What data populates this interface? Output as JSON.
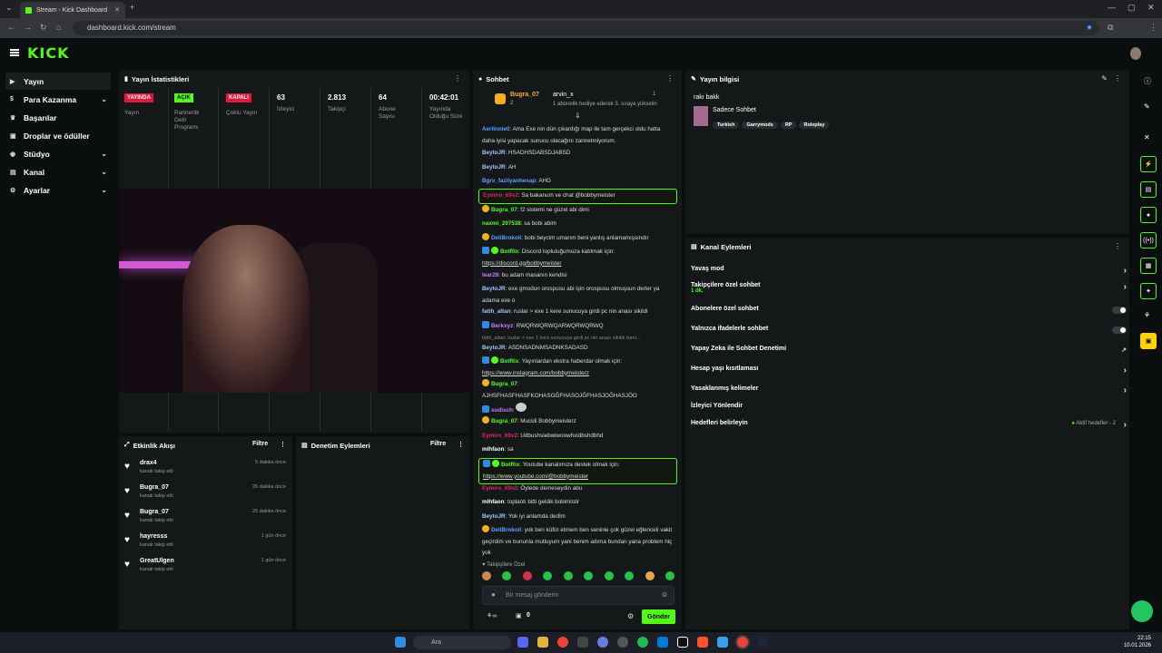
{
  "browser": {
    "tab_title": "Stream - Kick Dashboard",
    "url": "dashboard.kick.com/stream"
  },
  "brand": {
    "logo_text": "KICK",
    "accent": "#53fc18"
  },
  "sidebar": {
    "items": [
      {
        "label": "Yayın",
        "icon": "video-icon"
      },
      {
        "label": "Para Kazanma",
        "icon": "dollar-icon"
      },
      {
        "label": "Başarılar",
        "icon": "trophy-icon"
      },
      {
        "label": "Droplar ve ödüller",
        "icon": "gift-icon"
      },
      {
        "label": "Stüdyo",
        "icon": "studio-icon"
      },
      {
        "label": "Kanal",
        "icon": "channel-icon"
      },
      {
        "label": "Ayarlar",
        "icon": "gear-icon"
      }
    ]
  },
  "stats": {
    "title": "Yayın İstatistikleri",
    "items": [
      {
        "value": "YAYINDA",
        "label": "Yayın"
      },
      {
        "value": "AÇIK",
        "label": "Partnerlik Gelir Programı"
      },
      {
        "value": "KAPALI",
        "label": "Çoklu Yayın"
      },
      {
        "value": "63",
        "label": "İzleyici"
      },
      {
        "value": "2.813",
        "label": "Takipçi"
      },
      {
        "value": "64",
        "label": "Abone Sayısı"
      },
      {
        "value": "00:42:01",
        "label": "Yayında Olduğu Süre"
      }
    ]
  },
  "activity": {
    "title": "Etkinlik Akışı",
    "filter": "Filtre",
    "rows": [
      {
        "name": "drax4",
        "sub": "kanalı takip etti",
        "time": "5 dakika önce"
      },
      {
        "name": "Bugra_07",
        "sub": "kanalı takip etti",
        "time": "26 dakika önce"
      },
      {
        "name": "Bugra_07",
        "sub": "kanalı takip etti",
        "time": "26 dakika önce"
      },
      {
        "name": "hayresss",
        "sub": "kanalı takip etti",
        "time": "1 gün önce"
      },
      {
        "name": "GreatUlgen",
        "sub": "kanalı takip etti",
        "time": "1 gün önce"
      }
    ]
  },
  "moderation": {
    "title": "Denetim Eylemleri",
    "filter": "Filtre"
  },
  "chat": {
    "title": "Sohbet",
    "pinned": {
      "user1": "Bugra_07",
      "user2": "arvin_x",
      "count": "2",
      "count2": "1",
      "note": "1 abonelik hediye ederek 3. sıraya yükselin"
    },
    "messages": [
      {
        "user": "Aerlinnie0",
        "color": "#5aa0ff",
        "text": "Ama Exe nin dün çıkardığı map ile tam gerçekci oldu hatta daha iyisi yapacak sunucu olacağını zannetmiyorum."
      },
      {
        "user": "BeytoJR",
        "color": "#9fc8ff",
        "text": "HSADHSDABSDJABSD"
      },
      {
        "user": "BeytoJR",
        "color": "#9fc8ff",
        "text": "AH"
      },
      {
        "user": "Bgrv_faziiyanhesap",
        "color": "#5aa0ff",
        "text": "AHG"
      },
      {
        "user": "Eymiro_69v2",
        "color": "#e0245e",
        "text": "Sa bakanum ve chat @bobbymeister"
      },
      {
        "user": "Bugra_07",
        "color": "#53fc18",
        "text": "f2 sistemi ne güzel abi dimi"
      },
      {
        "user": "naxmi_297538",
        "color": "#53fc18",
        "text": "sa bobi abim"
      },
      {
        "user": "DeliBrokoli",
        "color": "#5aa0ff",
        "text": "bobi beycim umarım beni yanlış anlamamışsındır"
      },
      {
        "user": "BotRix",
        "color": "#53fc18",
        "text": "Discord topluluğumuza katılmak için:",
        "link": "https://discord.gg/bobbymeister"
      },
      {
        "user": "lear28",
        "color": "#c77dff",
        "text": "bu adam masanın kendisi"
      },
      {
        "user": "BeytoJR",
        "color": "#9fc8ff",
        "text": "exe gmodun orospusu abi işin orospusu olmuşsun derler ya adama exe o"
      },
      {
        "user": "fatih_altan",
        "color": "#9fc8ff",
        "text": "ruslar > exe 1 kere sunucuya girdi pc nin anası sikildi"
      },
      {
        "user": "Berkxyz",
        "color": "#c77dff",
        "text": "RWQRWQRWQARWQRWQRWQ"
      },
      {
        "user": "BeytoJR",
        "color": "#9fc8ff",
        "text": "ASDNSADNMSADNKSADASD"
      },
      {
        "user": "BotRix",
        "color": "#53fc18",
        "text": "Yayınlardan ekstra haberdar olmak için:",
        "link": "https://www.instagram.com/bobbymeisterz"
      },
      {
        "user": "Bugra_07",
        "color": "#53fc18",
        "text": "AJHSFHASFHASFKOHASOĞFHASOJĞFHASJOĞHASJÖO"
      },
      {
        "user": "sudisch",
        "color": "#c77dff",
        "text": ""
      },
      {
        "user": "Bugra_07",
        "color": "#53fc18",
        "text": "Mucidi Bobbymeisterz"
      },
      {
        "user": "Eymiro_69v2",
        "color": "#e0245e",
        "text": "Udbushsiebwiwoowhxidbshdbhd"
      },
      {
        "user": "mlhfaon",
        "color": "#fff",
        "text": "sa"
      },
      {
        "user": "BotRix",
        "color": "#53fc18",
        "text": "Youtube kanalımıza destek olmak için:",
        "link": "https://www.youtube.com/@bobbymeister"
      },
      {
        "user": "Eymiro_69v2",
        "color": "#e0245e",
        "text": "Öylede demeseydin abu"
      },
      {
        "user": "mlhfaon",
        "color": "#fff",
        "text": "toplantı bitti geldik bobimistir"
      },
      {
        "user": "BeytoJR",
        "color": "#9fc8ff",
        "text": "Yok iyi anlamda dedim"
      },
      {
        "user": "DeliBrokoli",
        "color": "#5aa0ff",
        "text": "yok ben küfür etmem ben seninle çok güzel eğlenceli vakit geçirdim ve bununla mutluyum yani benim adıma bundan yana problem hiç yok"
      }
    ],
    "system_line": "fatih_altan: ruslar > exe 1 kere sunucuya girdi pc nin anası sikildi isimi...",
    "followers_only": "Takipçilere Özel",
    "input_placeholder": "Bir mesaj gönderin",
    "send_label": "Gönder",
    "points": "0"
  },
  "stream_info": {
    "title": "Yayın bilgisi",
    "stream_title": "rakı bakk",
    "category": "Sadece Sohbet",
    "tags": [
      "Turkish",
      "Garrymods",
      "RP",
      "Roleplay"
    ]
  },
  "channel_actions": {
    "title": "Kanal Eylemleri",
    "rows": [
      {
        "label": "Yavaş mod",
        "type": "chevron"
      },
      {
        "label": "Takipçilere özel sohbet",
        "sub": "1 dk.",
        "type": "chevron"
      },
      {
        "label": "Abonelere özel sohbet",
        "type": "toggle"
      },
      {
        "label": "Yalnızca ifadelerle sohbet",
        "type": "toggle"
      },
      {
        "label": "Yapay Zeka ile Sohbet Denetimi",
        "type": "external"
      },
      {
        "label": "Hesap yaşı kısıtlaması",
        "type": "chevron"
      },
      {
        "label": "Yasaklanmış kelimeler",
        "type": "chevron"
      },
      {
        "label": "İzleyici Yönlendir",
        "type": "none"
      },
      {
        "label": "Hedefleri belirleyin",
        "type": "chevron",
        "status": "Aktif hedefler - 2"
      }
    ]
  },
  "taskbar": {
    "search": "Ara",
    "time": "22:15",
    "date": "10.01.2026"
  }
}
